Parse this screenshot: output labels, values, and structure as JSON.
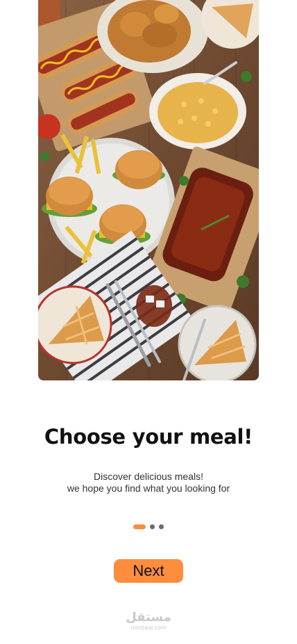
{
  "hero": {
    "image": "food-spread-image"
  },
  "onboarding": {
    "title": "Choose your meal!",
    "subtitle_line1": "Discover delicious meals!",
    "subtitle_line2": "we hope you find what you looking for",
    "page_indicator": {
      "current": 1,
      "total": 3
    },
    "next_label": "Next"
  },
  "watermark": {
    "logo_text": "مستقل",
    "domain": "mostaql.com"
  },
  "colors": {
    "accent": "#fe8d3e",
    "dot_inactive": "#6b6b6b",
    "title": "#111111"
  }
}
